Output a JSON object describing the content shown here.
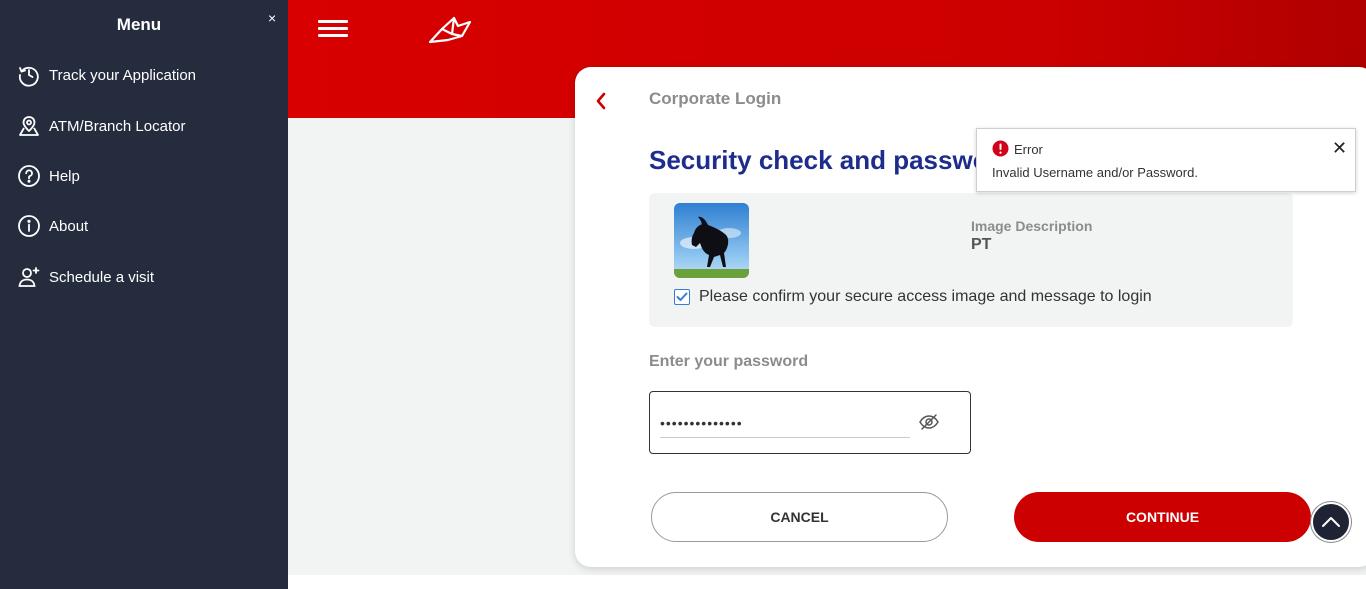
{
  "sidebar": {
    "title": "Menu",
    "close_symbol": "×",
    "items": [
      {
        "label": "Track your Application",
        "icon": "history-icon"
      },
      {
        "label": "ATM/Branch Locator",
        "icon": "map-pin-icon"
      },
      {
        "label": "Help",
        "icon": "help-icon"
      },
      {
        "label": "About",
        "icon": "info-icon"
      },
      {
        "label": "Schedule a visit",
        "icon": "add-person-icon"
      }
    ]
  },
  "header": {
    "brand_color": "#cc0000"
  },
  "card": {
    "breadcrumb": "Corporate Login",
    "heading": "Security check and password",
    "secure_image": {
      "description_label": "Image Description",
      "description_value": "PT",
      "confirm_text": "Please confirm your secure access image and message to login",
      "confirmed": true
    },
    "password": {
      "label": "Enter your password",
      "value": "••••••••••••••"
    },
    "buttons": {
      "cancel": "CANCEL",
      "continue": "CONTINUE"
    }
  },
  "toast": {
    "title": "Error",
    "message": "Invalid Username and/or Password.",
    "close_symbol": "✕",
    "color": "#d0021b"
  }
}
